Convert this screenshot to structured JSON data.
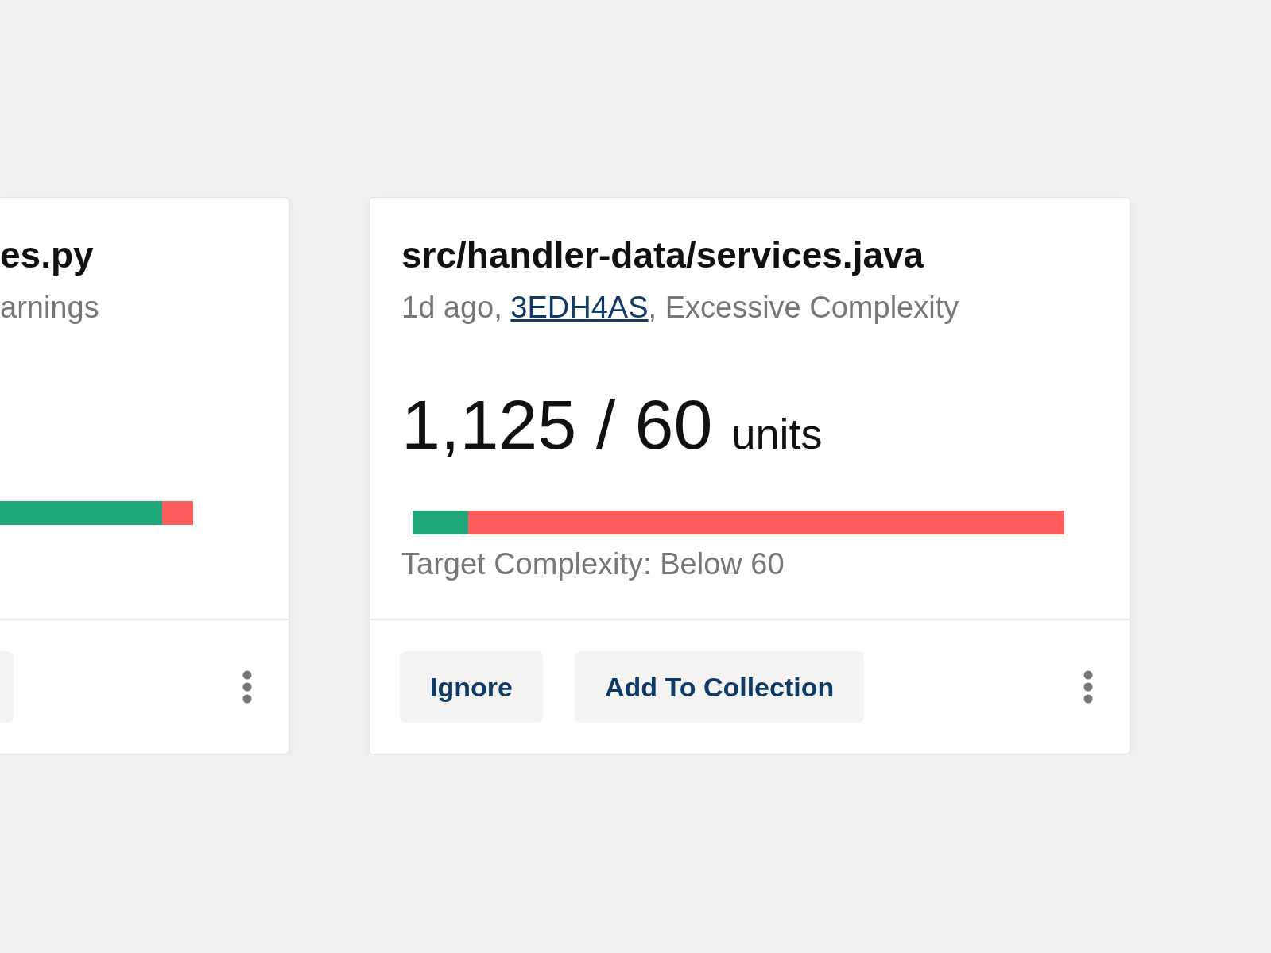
{
  "cards": [
    {
      "title": "es.py",
      "meta_before": "arnings",
      "level": 0.84,
      "partial": true
    },
    {
      "title": "src/handler-data/services.java",
      "meta_before": "1d ago, ",
      "commit": "3EDH4AS",
      "meta_after": ", Excessive Complexity",
      "value": "1,125 / 60",
      "unit": "units",
      "level": 0.085,
      "target": "Target Complexity: Below 60",
      "partial": false,
      "buttons": [
        "Ignore",
        "Add To Collection"
      ]
    }
  ]
}
